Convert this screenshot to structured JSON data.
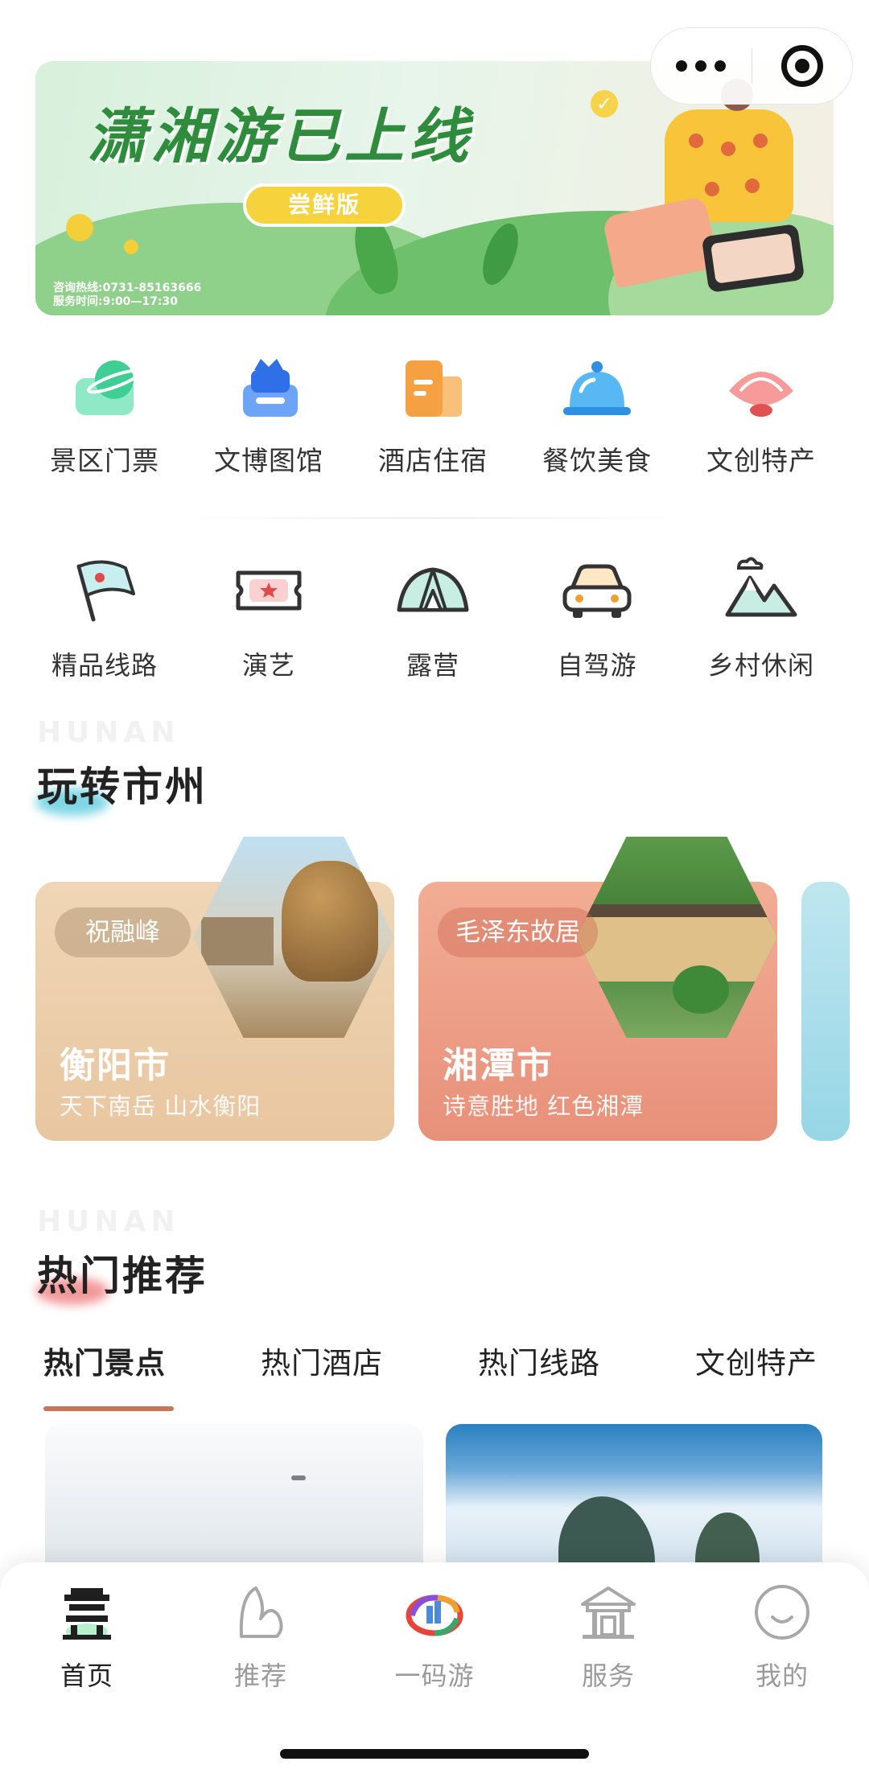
{
  "banner": {
    "title": "潇湘游已上线",
    "badge": "尝鲜版",
    "hotline": "咨询热线:0731-85163666",
    "hours": "服务时间:9:00—17:30"
  },
  "quick_menu": {
    "row1": [
      {
        "label": "景区门票",
        "icon": "ticket-planet-icon",
        "color": "#5ad3a8"
      },
      {
        "label": "文博图馆",
        "icon": "museum-icon",
        "color": "#3f7df0"
      },
      {
        "label": "酒店住宿",
        "icon": "hotel-building-icon",
        "color": "#f4a23a"
      },
      {
        "label": "餐饮美食",
        "icon": "food-cloche-icon",
        "color": "#3aa6f0"
      },
      {
        "label": "文创特产",
        "icon": "fan-icon",
        "color": "#f07a7a"
      }
    ],
    "row2": [
      {
        "label": "精品线路",
        "icon": "flag-icon"
      },
      {
        "label": "演艺",
        "icon": "ticket-star-icon"
      },
      {
        "label": "露营",
        "icon": "tent-icon"
      },
      {
        "label": "自驾游",
        "icon": "car-icon"
      },
      {
        "label": "乡村休闲",
        "icon": "mountains-icon"
      }
    ]
  },
  "cities_section": {
    "ghost": "HUNAN",
    "title": "玩转市州",
    "cards": [
      {
        "tag": "祝融峰",
        "name": "衡阳市",
        "subtitle": "天下南岳 山水衡阳"
      },
      {
        "tag": "毛泽东故居",
        "name": "湘潭市",
        "subtitle": "诗意胜地 红色湘潭"
      }
    ]
  },
  "hot_section": {
    "ghost": "HUNAN",
    "title": "热门推荐",
    "tabs": [
      "热门景点",
      "热门酒店",
      "热门线路",
      "文创特产"
    ],
    "active_tab": 0
  },
  "tabbar": {
    "items": [
      {
        "label": "首页",
        "icon": "home-tower-icon"
      },
      {
        "label": "推荐",
        "icon": "recommend-icon"
      },
      {
        "label": "一码游",
        "icon": "code-tour-icon"
      },
      {
        "label": "服务",
        "icon": "service-pavilion-icon"
      },
      {
        "label": "我的",
        "icon": "profile-smile-icon"
      }
    ],
    "active": 0
  }
}
